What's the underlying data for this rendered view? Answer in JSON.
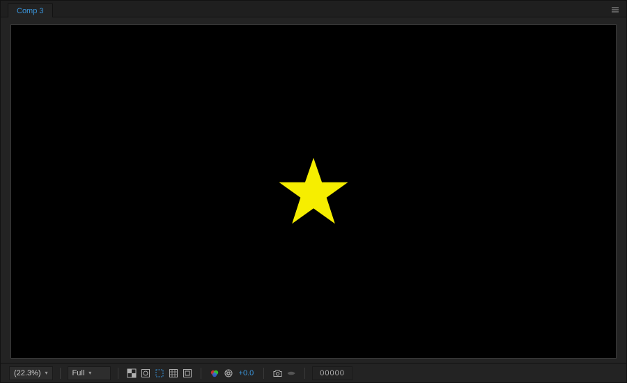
{
  "tab": {
    "label": "Comp 3"
  },
  "shape": {
    "fill": "#f6ee00"
  },
  "statusbar": {
    "magnification": "(22.3%)",
    "resolution": "Full",
    "exposure": "+0.0",
    "timecode": "00000"
  }
}
